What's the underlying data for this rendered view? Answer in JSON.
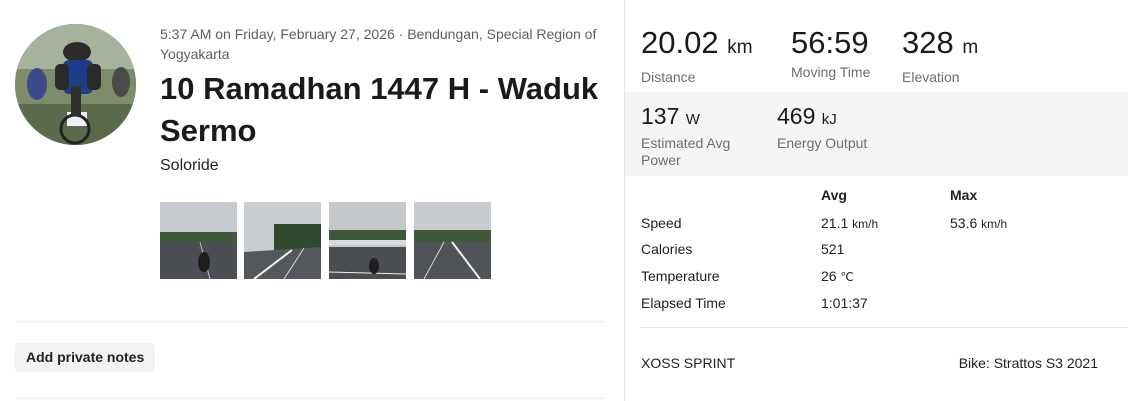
{
  "activity": {
    "meta": "5:37 AM on Friday, February 27, 2026 · Bendungan, Special Region of Yogyakarta",
    "title": "10 Ramadhan 1447 H - Waduk Sermo",
    "subtitle": "Soloride",
    "photos": [
      "photo-1",
      "photo-2",
      "photo-3",
      "photo-4"
    ],
    "notes_button": "Add private notes"
  },
  "stats": {
    "distance": {
      "value": "20.02",
      "unit": "km",
      "label": "Distance"
    },
    "moving_time": {
      "value": "56:59",
      "label": "Moving Time"
    },
    "elevation": {
      "value": "328",
      "unit": "m",
      "label": "Elevation"
    },
    "power": {
      "value": "137",
      "unit": "W",
      "label": "Estimated Avg Power"
    },
    "energy": {
      "value": "469",
      "unit": "kJ",
      "label": "Energy Output"
    }
  },
  "table": {
    "headers": {
      "avg": "Avg",
      "max": "Max"
    },
    "rows": [
      {
        "name": "Speed",
        "avg": "21.1",
        "avg_unit": "km/h",
        "max": "53.6",
        "max_unit": "km/h"
      },
      {
        "name": "Calories",
        "avg": "521"
      },
      {
        "name": "Temperature",
        "avg": "26",
        "avg_unit": "℃"
      },
      {
        "name": "Elapsed Time",
        "avg": "1:01:37"
      }
    ]
  },
  "device": "XOSS SPRINT",
  "bike": "Bike: Strattos S3 2021",
  "colors": {
    "band": "#f5f5f5",
    "text": "#222222",
    "muted": "#6d6d6d"
  }
}
